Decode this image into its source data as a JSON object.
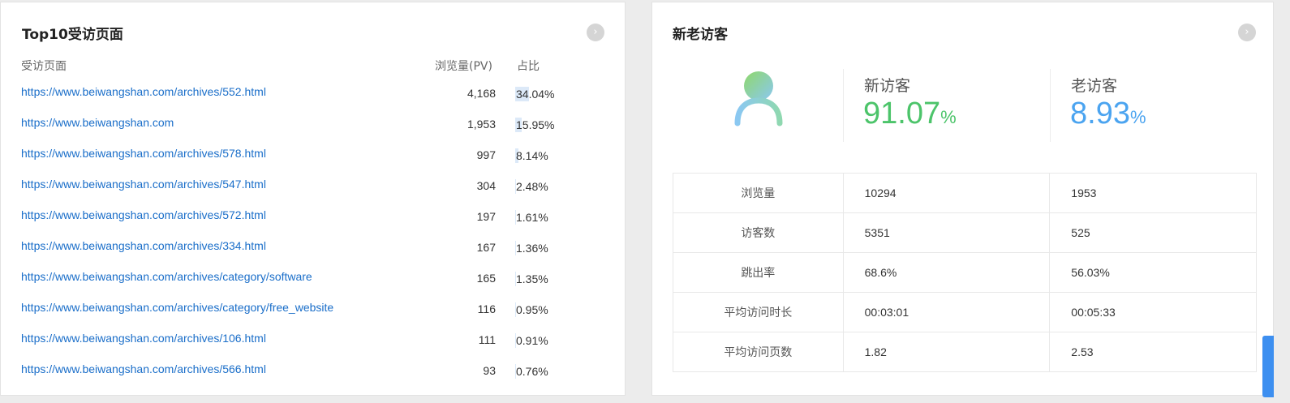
{
  "top_pages": {
    "title": "Top10受访页面",
    "more_icon": "chevron-right-icon",
    "columns": {
      "page": "受访页面",
      "pv": "浏览量(PV)",
      "ratio": "占比"
    },
    "rows": [
      {
        "url": "https://www.beiwangshan.com/archives/552.html",
        "pv": "4,168",
        "ratio": "34.04%",
        "ratio_value": 34.04
      },
      {
        "url": "https://www.beiwangshan.com",
        "pv": "1,953",
        "ratio": "15.95%",
        "ratio_value": 15.95
      },
      {
        "url": "https://www.beiwangshan.com/archives/578.html",
        "pv": "997",
        "ratio": "8.14%",
        "ratio_value": 8.14
      },
      {
        "url": "https://www.beiwangshan.com/archives/547.html",
        "pv": "304",
        "ratio": "2.48%",
        "ratio_value": 2.48
      },
      {
        "url": "https://www.beiwangshan.com/archives/572.html",
        "pv": "197",
        "ratio": "1.61%",
        "ratio_value": 1.61
      },
      {
        "url": "https://www.beiwangshan.com/archives/334.html",
        "pv": "167",
        "ratio": "1.36%",
        "ratio_value": 1.36
      },
      {
        "url": "https://www.beiwangshan.com/archives/category/software",
        "pv": "165",
        "ratio": "1.35%",
        "ratio_value": 1.35
      },
      {
        "url": "https://www.beiwangshan.com/archives/category/free_website",
        "pv": "116",
        "ratio": "0.95%",
        "ratio_value": 0.95
      },
      {
        "url": "https://www.beiwangshan.com/archives/106.html",
        "pv": "111",
        "ratio": "0.91%",
        "ratio_value": 0.91
      },
      {
        "url": "https://www.beiwangshan.com/archives/566.html",
        "pv": "93",
        "ratio": "0.76%",
        "ratio_value": 0.76
      }
    ]
  },
  "visitors": {
    "title": "新老访客",
    "more_icon": "chevron-right-icon",
    "avatar_icon": "user-icon",
    "new": {
      "label": "新访客",
      "value": "91.07",
      "unit": "%"
    },
    "old": {
      "label": "老访客",
      "value": "8.93",
      "unit": "%"
    },
    "rows": [
      {
        "label": "浏览量",
        "new": "10294",
        "old": "1953"
      },
      {
        "label": "访客数",
        "new": "5351",
        "old": "525"
      },
      {
        "label": "跳出率",
        "new": "68.6%",
        "old": "56.03%"
      },
      {
        "label": "平均访问时长",
        "new": "00:03:01",
        "old": "00:05:33"
      },
      {
        "label": "平均访问页数",
        "new": "1.82",
        "old": "2.53"
      }
    ]
  },
  "colors": {
    "link": "#1a6ec9",
    "new_visitor": "#4cc46a",
    "old_visitor": "#4ba4f0",
    "ratio_bar": "#dce9f8"
  }
}
